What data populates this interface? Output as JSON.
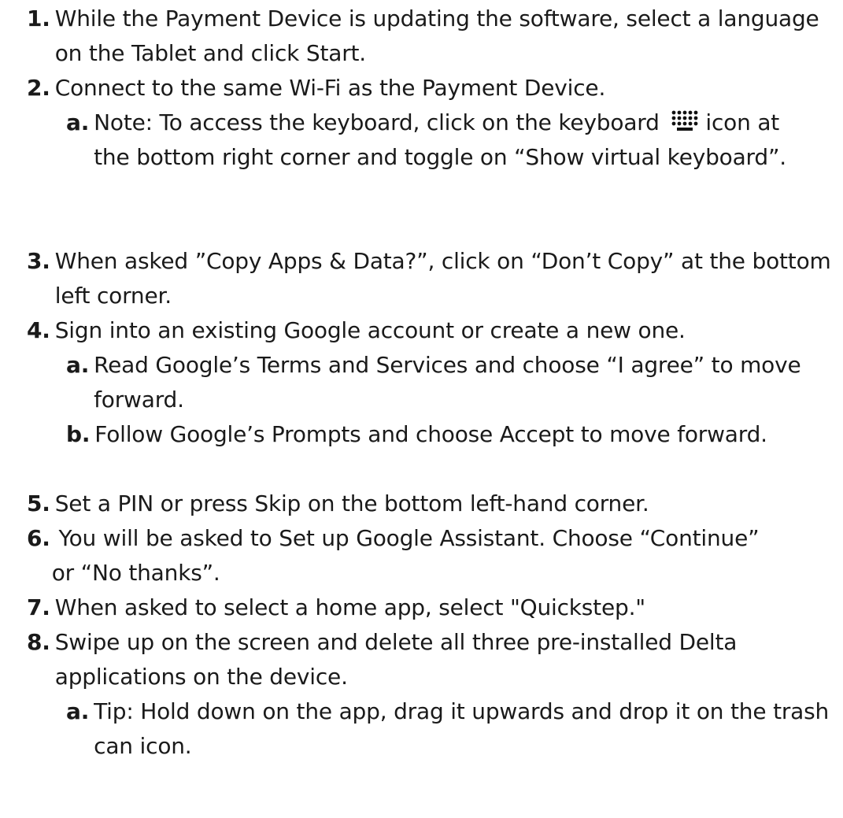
{
  "steps": [
    {
      "num": "1.",
      "text": "While the Payment Device is updating the software, select a language on the Tablet and click Start."
    },
    {
      "num": "2.",
      "text": "Connect to the same Wi-Fi as the Payment Device."
    },
    {
      "num": "a.",
      "text_before": "Note: To access the keyboard, click on the keyboard",
      "text_after": "icon at the bottom right corner and toggle on “Show virtual keyboard”.",
      "icon": "keyboard-icon"
    },
    {
      "num": "3.",
      "text": "When asked ”Copy Apps & Data?”, click on “Don’t Copy” at the bottom left corner."
    },
    {
      "num": "4.",
      "text": "Sign into an existing Google account or create a new one."
    },
    {
      "num": "a.",
      "text": "Read Google’s Terms and Services and choose “I agree” to move forward."
    },
    {
      "num": "b.",
      "text": "Follow Google’s Prompts and choose Accept to move forward."
    },
    {
      "num": "5.",
      "text": "Set a PIN or press Skip on the bottom left-hand corner."
    },
    {
      "num": "6.",
      "text": " You will be asked to Set up Google Assistant. Choose “Continue” or “No thanks”."
    },
    {
      "num": "7.",
      "text": "When asked to select a home app, select \"Quickstep.\""
    },
    {
      "num": "8.",
      "text": "Swipe up on the screen and delete all three pre-installed Delta applications on the device."
    },
    {
      "num": "a.",
      "text": "Tip: Hold down on the app, drag it upwards and drop it on the trash can icon."
    }
  ]
}
